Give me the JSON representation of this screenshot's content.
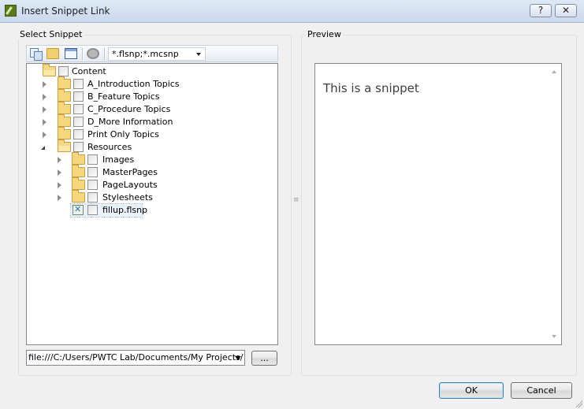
{
  "window": {
    "title": "Insert Snippet Link",
    "help_label": "?",
    "close_label": "✕"
  },
  "select_group": {
    "label": "Select Snippet",
    "filter_value": "*.flsnp;*.mcsnp",
    "toolbar_icons": [
      "copy-icon",
      "folder-icon",
      "view-icon",
      "gear-icon"
    ]
  },
  "tree": {
    "root": "Content",
    "items": [
      "A_Introduction Topics",
      "B_Feature Topics",
      "C_Procedure Topics",
      "D_More Information",
      "Print Only Topics",
      "Resources"
    ],
    "resources_children": [
      "Images",
      "MasterPages",
      "PageLayouts",
      "Stylesheets"
    ],
    "snippet_file": "fillup.flsnp"
  },
  "path": {
    "value": "file:///C:/Users/PWTC Lab/Documents/My Projects/",
    "browse_label": "..."
  },
  "preview_group": {
    "label": "Preview",
    "text": "This is a snippet"
  },
  "buttons": {
    "ok": "OK",
    "cancel": "Cancel"
  }
}
